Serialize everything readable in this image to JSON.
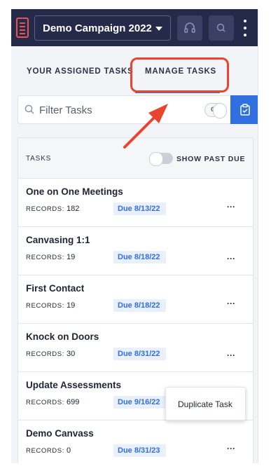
{
  "header": {
    "campaign": "Demo Campaign 2022",
    "icons": [
      "app-logo",
      "headset-icon",
      "search-icon",
      "more-vertical-icon"
    ]
  },
  "tabs": {
    "assigned": "YOUR ASSIGNED TASKS",
    "manage": "MANAGE TASKS",
    "active": "manage"
  },
  "filter": {
    "placeholder": "Filter Tasks",
    "or_toggle": "OR"
  },
  "tasks_panel": {
    "title": "TASKS",
    "show_past_due": "SHOW PAST DUE",
    "records_label": "RECORDS:",
    "items": [
      {
        "name": "One on One Meetings",
        "records": "182",
        "due": "Due 8/13/22"
      },
      {
        "name": "Canvasing 1:1",
        "records": "19",
        "due": "Due 8/18/22"
      },
      {
        "name": "First Contact",
        "records": "19",
        "due": "Due 8/18/22"
      },
      {
        "name": "Knock on Doors",
        "records": "30",
        "due": "Due 8/31/22"
      },
      {
        "name": "Update Assessments",
        "records": "699",
        "due": "Due 9/16/22"
      },
      {
        "name": "Demo Canvass",
        "records": "0",
        "due": "Due 8/31/23"
      }
    ],
    "row_menu": "···"
  },
  "context_menu": {
    "duplicate": "Duplicate Task"
  },
  "colors": {
    "topbar": "#252a4a",
    "accent": "#2f6fe0",
    "highlight": "#e8442f",
    "brand": "#e8544e"
  }
}
